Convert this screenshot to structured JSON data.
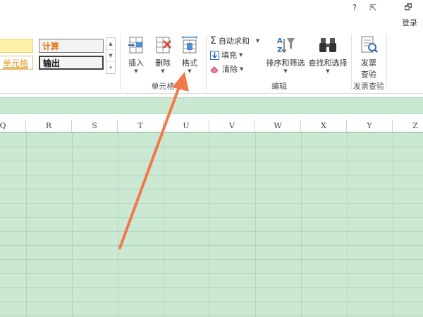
{
  "window": {
    "help_label": "?",
    "ribbon_display_label": "⇱",
    "restore_label": "🗗",
    "login_label": "登录"
  },
  "cell_styles": {
    "left_top": "",
    "left_bottom": "单元格",
    "calc": "计算",
    "output": "输出"
  },
  "ribbon": {
    "cells_group": {
      "label": "单元格",
      "insert_label": "插入",
      "delete_label": "删除",
      "format_label": "格式"
    },
    "editing_group": {
      "label": "编辑",
      "autosum_label": "自动求和",
      "fill_label": "填充",
      "clear_label": "清除",
      "sort_filter_label": "排序和筛选",
      "find_select_label": "查找和选择"
    },
    "invoice_group": {
      "label": "发票查验",
      "invoice_btn_line1": "发票",
      "invoice_btn_line2": "查验"
    }
  },
  "columns": [
    "Q",
    "R",
    "S",
    "T",
    "U",
    "V",
    "W",
    "X",
    "Y",
    "Z"
  ],
  "colors": {
    "grid_bg": "#cbe8d3",
    "annotation_arrow": "#f07a4a"
  }
}
